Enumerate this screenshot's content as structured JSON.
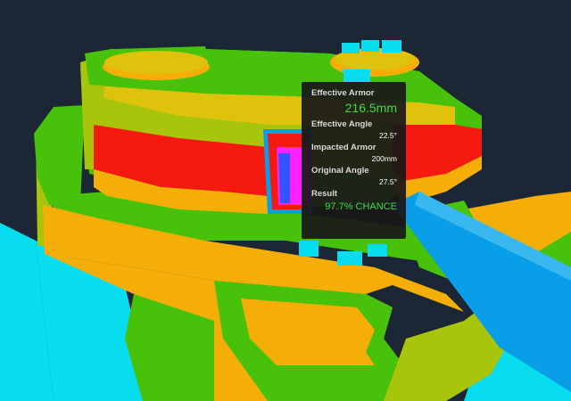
{
  "colors": {
    "background": "#1b2735",
    "armor_green": "#47c10a",
    "armor_yellow_green": "#a8c40b",
    "armor_yellow": "#dec20c",
    "armor_orange": "#f5ae08",
    "armor_red": "#f51a0f",
    "armor_cyan": "#08ddef",
    "gun_blue": "#0a9ee8",
    "magenta": "#ff22ff",
    "accent_green": "#3fd94a"
  },
  "tooltip": {
    "effective_armor_label": "Effective Armor",
    "effective_armor_value": "216.5mm",
    "effective_angle_label": "Effective Angle",
    "effective_angle_value": "22.5°",
    "impacted_armor_label": "Impacted Armor",
    "impacted_armor_value": "200mm",
    "original_angle_label": "Original Angle",
    "original_angle_value": "27.5°",
    "result_label": "Result",
    "result_value": "97.7% CHANCE"
  }
}
